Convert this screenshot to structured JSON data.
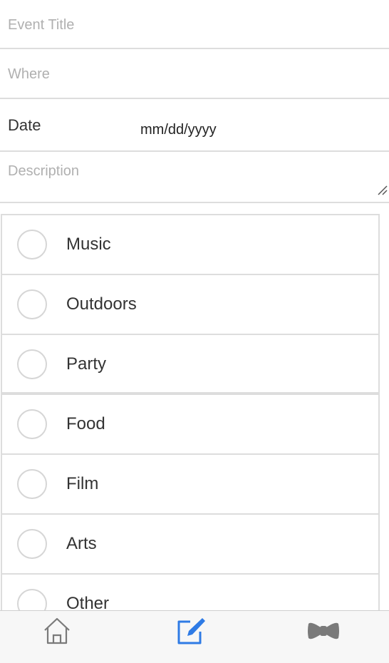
{
  "form": {
    "title_placeholder": "Event Title",
    "where_placeholder": "Where",
    "date_label": "Date",
    "date_value": "mm/dd/yyyy",
    "description_placeholder": "Description"
  },
  "categories": [
    "Music",
    "Outdoors",
    "Party",
    "Food",
    "Film",
    "Arts",
    "Other"
  ],
  "tabbar": {
    "tabs": [
      "home-icon",
      "edit-icon",
      "bowtie-icon"
    ],
    "active_tab": "edit-icon",
    "active_color": "#2f7be5",
    "inactive_color": "#7a7a7a"
  }
}
